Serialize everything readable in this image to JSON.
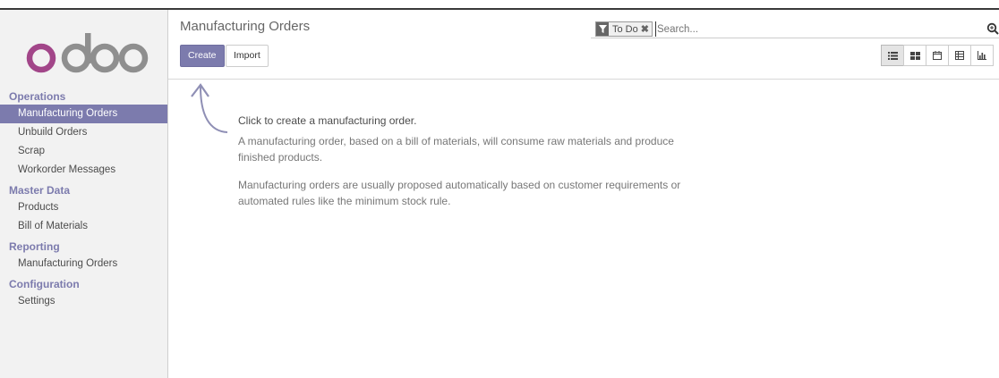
{
  "app": {
    "logo_text": "odoo"
  },
  "sidebar": {
    "sections": [
      {
        "label": "Operations",
        "items": [
          {
            "label": "Manufacturing Orders",
            "active": true
          },
          {
            "label": "Unbuild Orders"
          },
          {
            "label": "Scrap"
          },
          {
            "label": "Workorder Messages"
          }
        ]
      },
      {
        "label": "Master Data",
        "items": [
          {
            "label": "Products"
          },
          {
            "label": "Bill of Materials"
          }
        ]
      },
      {
        "label": "Reporting",
        "items": [
          {
            "label": "Manufacturing Orders"
          }
        ]
      },
      {
        "label": "Configuration",
        "items": [
          {
            "label": "Settings"
          }
        ]
      }
    ]
  },
  "control_panel": {
    "breadcrumb": "Manufacturing Orders",
    "create_label": "Create",
    "import_label": "Import",
    "search": {
      "facet_label": "To Do",
      "facet_icon": "filter-icon",
      "placeholder": "Search..."
    },
    "views": [
      "list-view-icon",
      "kanban-view-icon",
      "calendar-view-icon",
      "pivot-view-icon",
      "graph-view-icon"
    ],
    "active_view": "list-view-icon"
  },
  "help": {
    "title": "Click to create a manufacturing order.",
    "paragraph1": "A manufacturing order, based on a bill of materials, will consume raw materials and produce finished products.",
    "paragraph2": "Manufacturing orders are usually proposed automatically based on customer requirements or automated rules like the minimum stock rule."
  },
  "colors": {
    "brand": "#7c7bad",
    "logo_accent": "#a24689",
    "logo_gray": "#8f8f8f"
  }
}
